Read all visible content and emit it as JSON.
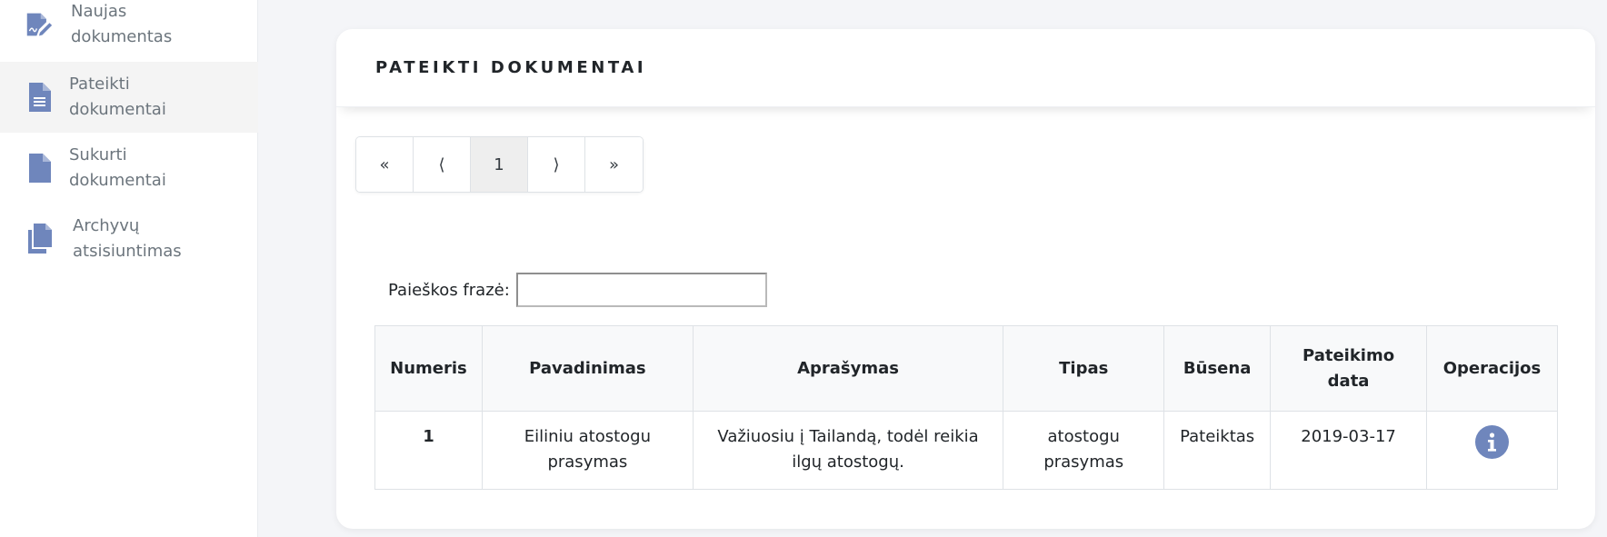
{
  "sidebar": {
    "items": [
      {
        "label": "Naujas\ndokumentas",
        "icon": "edit-document-icon"
      },
      {
        "label": "Pateikti\ndokumentai",
        "icon": "document-lines-icon",
        "active": true
      },
      {
        "label": "Sukurti\ndokumentai",
        "icon": "document-icon"
      },
      {
        "label": "Archyvų\natsisiuntimas",
        "icon": "copy-documents-icon"
      }
    ]
  },
  "card": {
    "title": "PATEIKTI DOKUMENTAI"
  },
  "pagination": {
    "first": "«",
    "prev": "⟨",
    "current": "1",
    "next": "⟩",
    "last": "»"
  },
  "search": {
    "label": "Paieškos frazė:",
    "value": ""
  },
  "table": {
    "columns": [
      "Numeris",
      "Pavadinimas",
      "Aprašymas",
      "Tipas",
      "Būsena",
      "Pateikimo data",
      "Operacijos"
    ],
    "rows": [
      {
        "number": "1",
        "name": "Eiliniu atostogu prasymas",
        "description": "Važiuosiu į Tailandą, todėl reikia ilgų atostogų.",
        "type": "atostogu prasymas",
        "status": "Pateiktas",
        "date": "2019-03-17",
        "operation_icon": "info-icon"
      }
    ]
  },
  "colors": {
    "accent": "#6f86bc",
    "sidebar_active_bg": "#f4f4f4",
    "page_bg": "#f4f5f8"
  }
}
